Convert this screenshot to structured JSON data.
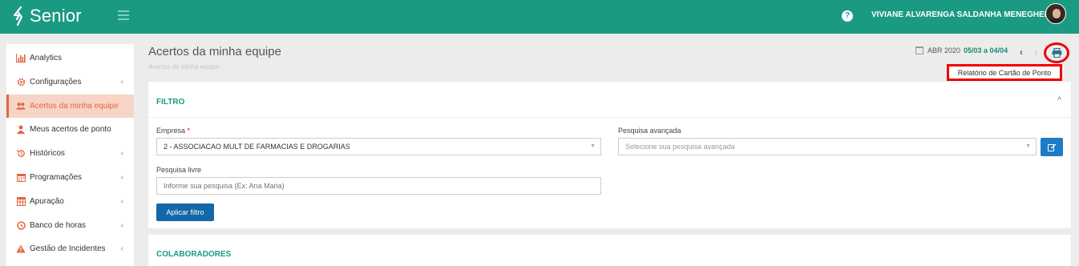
{
  "header": {
    "logo_text": "Senior",
    "help_symbol": "?",
    "user_name": "VIVIANE ALVARENGA SALDANHA MENEGHELLO",
    "brand_color": "#1b9a82"
  },
  "sidebar": {
    "items": [
      {
        "label": "Analytics",
        "icon": "bar-chart-icon",
        "active": false,
        "expandable": false
      },
      {
        "label": "Configurações",
        "icon": "gear-icon",
        "active": false,
        "expandable": true
      },
      {
        "label": "Acertos da minha equipe",
        "icon": "users-icon",
        "active": true,
        "expandable": false
      },
      {
        "label": "Meus acertos de ponto",
        "icon": "user-icon",
        "active": false,
        "expandable": false
      },
      {
        "label": "Históricos",
        "icon": "history-icon",
        "active": false,
        "expandable": true
      },
      {
        "label": "Programações",
        "icon": "calendar-icon",
        "active": false,
        "expandable": true
      },
      {
        "label": "Apuração",
        "icon": "table-icon",
        "active": false,
        "expandable": true
      },
      {
        "label": "Banco de horas",
        "icon": "clock-icon",
        "active": false,
        "expandable": true
      },
      {
        "label": "Gestão de Incidentes",
        "icon": "warning-icon",
        "active": false,
        "expandable": true
      }
    ]
  },
  "page": {
    "title": "Acertos da minha equipe",
    "breadcrumb": "Acertos da minha equipe"
  },
  "period": {
    "month": "ABR 2020",
    "range": "05/03 a 04/04",
    "prev_symbol": "‹",
    "next_symbol": "›",
    "print_tooltip": "Relatório de Cartão de Ponto"
  },
  "filter": {
    "title": "FILTRO",
    "collapse_symbol": "^",
    "empresa_label": "Empresa",
    "required_mark": "*",
    "empresa_value": "2 - ASSOCIACAO MULT DE FARMACIAS E DROGARIAS",
    "advanced_label": "Pesquisa avançada",
    "advanced_placeholder": "Selecione sua pesquisa avançada",
    "free_label": "Pesquisa livre",
    "free_placeholder": "Informe sua pesquisa (Ex: Ana Maria)",
    "apply_label": "Aplicar filtro"
  },
  "collaborators": {
    "title": "COLABORADORES"
  }
}
